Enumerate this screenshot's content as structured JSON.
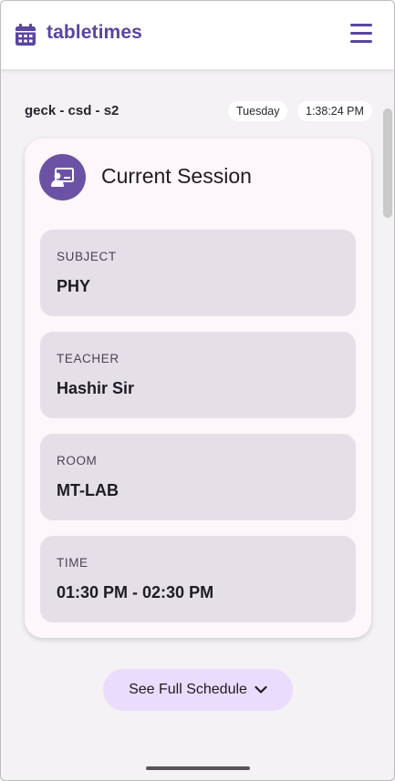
{
  "appbar": {
    "brand_name": "tabletimes",
    "brand_icon": "calendar-icon",
    "menu_icon": "hamburger-menu-icon",
    "brand_color": "#5a45a0"
  },
  "status": {
    "class_name": "geck - csd - s2",
    "day": "Tuesday",
    "time": "1:38:24 PM"
  },
  "current_session": {
    "title": "Current Session",
    "icon": "presentation-teacher-icon",
    "fields": [
      {
        "label": "SUBJECT",
        "value": "PHY"
      },
      {
        "label": "TEACHER",
        "value": "Hashir Sir"
      },
      {
        "label": "ROOM",
        "value": "MT-LAB"
      },
      {
        "label": "TIME",
        "value": "01:30 PM - 02:30 PM"
      }
    ]
  },
  "schedule_button": {
    "label": "See Full Schedule",
    "icon": "chevron-down-icon"
  }
}
